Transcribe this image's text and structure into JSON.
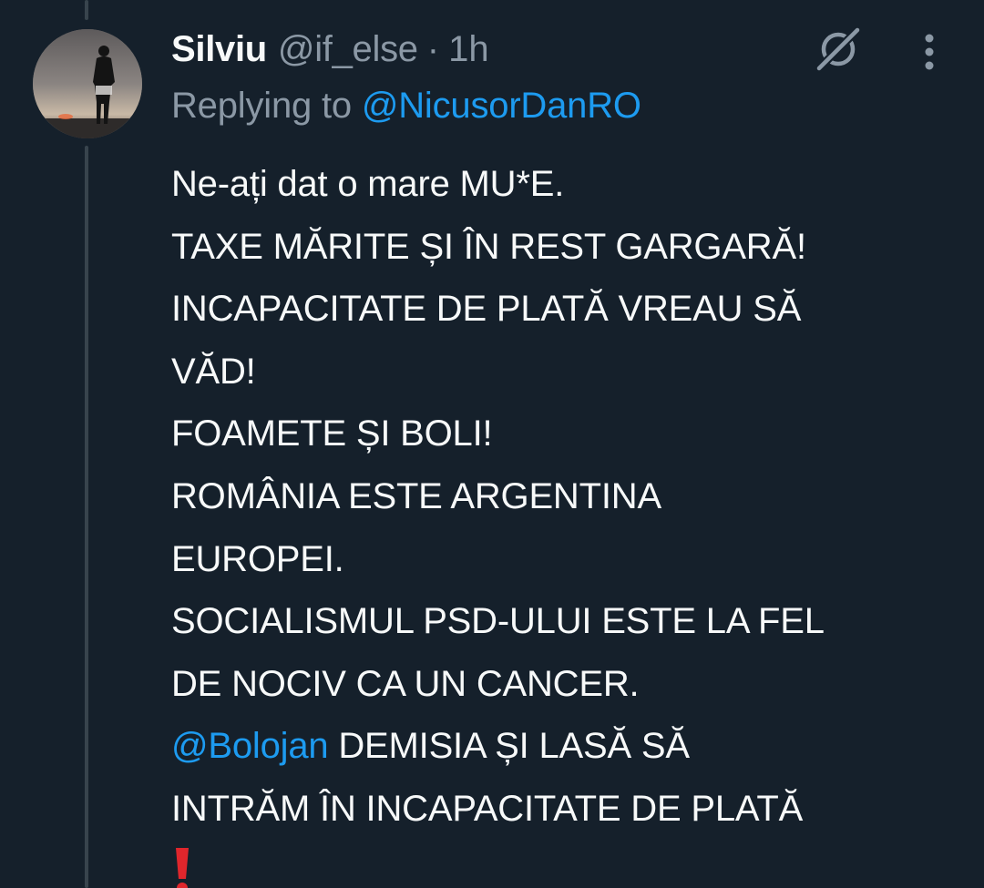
{
  "tweet": {
    "author": {
      "display_name": "Silviu",
      "handle": "@if_else",
      "separator": "·",
      "time": "1h"
    },
    "replying_prefix": "Replying to",
    "replying_to": "@NicusorDanRO",
    "lines": [
      "Ne-ați dat o mare MU*E.",
      "TAXE MĂRITE ȘI ÎN REST GARGARĂ!",
      "INCAPACITATE DE PLATĂ VREAU SĂ",
      "VĂD!",
      "FOAMETE ȘI BOLI!",
      "ROMÂNIA ESTE ARGENTINA",
      "EUROPEI.",
      "SOCIALISMUL PSD-ULUI ESTE LA FEL",
      "DE NOCIV CA UN CANCER."
    ],
    "mention_line": {
      "mention": "@Bolojan",
      "text": " DEMISIA ȘI LASĂ SĂ"
    },
    "last_line": "INTRĂM ÎN INCAPACITATE DE PLATĂ",
    "emoji": "exclamation-mark",
    "icons": {
      "grok": "grok-icon",
      "more": "more-dots-icon"
    },
    "colors": {
      "background": "#15202b",
      "text": "#f7f9f9",
      "secondary": "#8b98a5",
      "link": "#1d9bf0",
      "thread_line": "#38444d",
      "emoji_red": "#e0262c"
    }
  }
}
